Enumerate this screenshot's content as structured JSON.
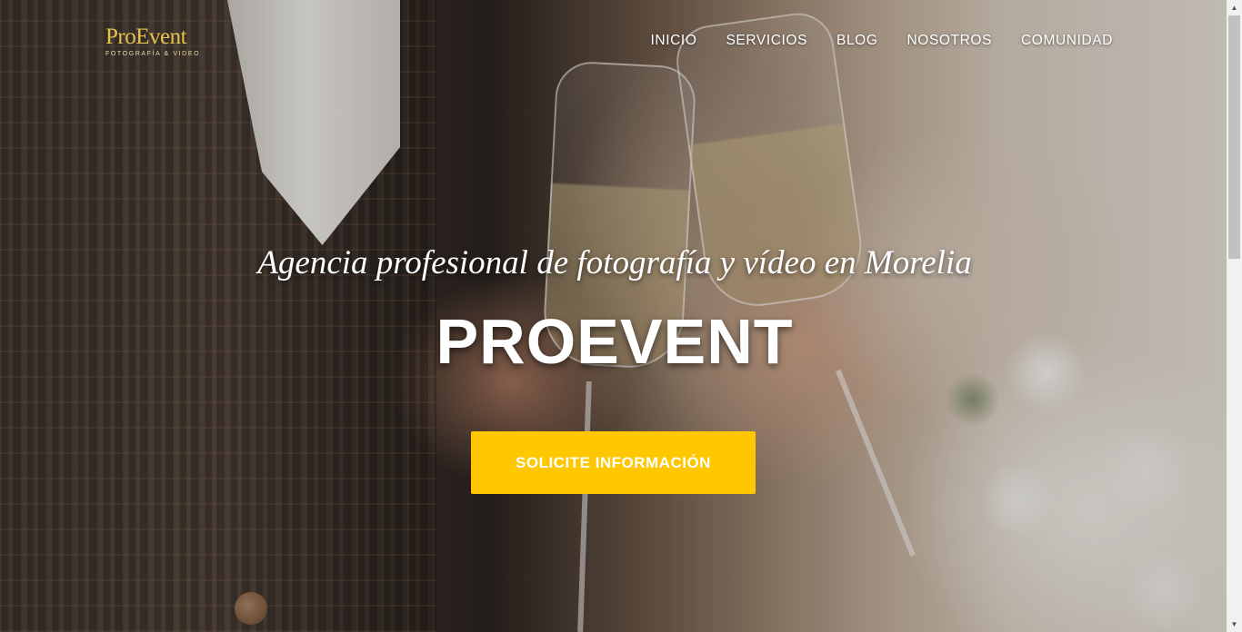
{
  "logo": {
    "main": "ProEvent",
    "sub": "FOTOGRAFÍA & VIDEO"
  },
  "nav": {
    "items": [
      "INICIO",
      "SERVICIOS",
      "BLOG",
      "NOSOTROS",
      "COMUNIDAD"
    ]
  },
  "hero": {
    "tagline": "Agencia profesional de fotografía y vídeo en Morelia",
    "title": "PROEVENT",
    "cta_label": "SOLICITE INFORMACIÓN"
  },
  "colors": {
    "accent": "#ffc700",
    "logo_gold": "#e8c34a",
    "text": "#ffffff"
  },
  "icons": {
    "scroll_up": "triangle-up-icon",
    "scroll_down": "triangle-down-icon"
  }
}
